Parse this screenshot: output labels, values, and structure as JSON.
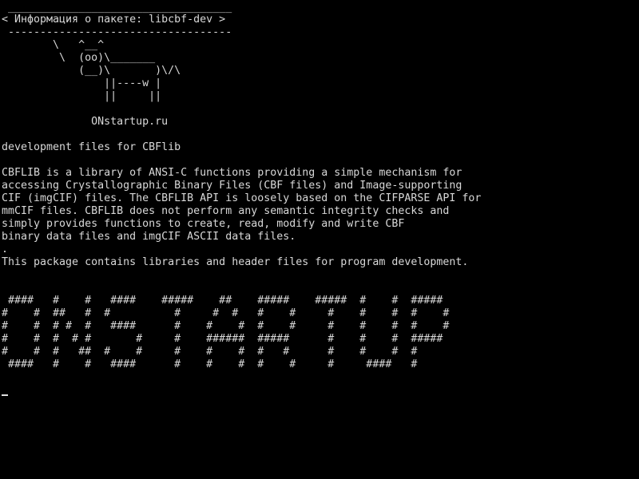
{
  "terminal": {
    "lines": [
      " ___________________________________",
      "< Информация о пакете: libcbf-dev >",
      " -----------------------------------",
      "        \\   ^__^",
      "         \\  (oo)\\_______",
      "            (__)\\       )\\/\\",
      "                ||----w |",
      "                ||     ||",
      "",
      "              ONstartup.ru",
      "",
      "development files for CBFlib",
      "",
      "CBFLIB is a library of ANSI-C functions providing a simple mechanism for",
      "accessing Crystallographic Binary Files (CBF files) and Image-supporting",
      "CIF (imgCIF) files. The CBFLIB API is loosely based on the CIFPARSE API for",
      "mmCIF files. CBFLIB does not perform any semantic integrity checks and",
      "simply provides functions to create, read, modify and write CBF",
      "binary data files and imgCIF ASCII data files.",
      ".",
      "This package contains libraries and header files for program development.",
      "",
      "",
      " ####   #    #   ####    #####    ##    #####    #####  #    #  #####",
      "#    #  ##   #  #          #     #  #   #    #     #    #    #  #    #",
      "#    #  # #  #   ####      #    #    #  #    #     #    #    #  #    #",
      "#    #  #  # #       #     #    ######  #####      #    #    #  #####",
      "#    #  #   ##  #    #     #    #    #  #   #      #    #    #  #",
      " ####   #    #   ####      #    #    #  #    #     #     ####   #"
    ]
  }
}
